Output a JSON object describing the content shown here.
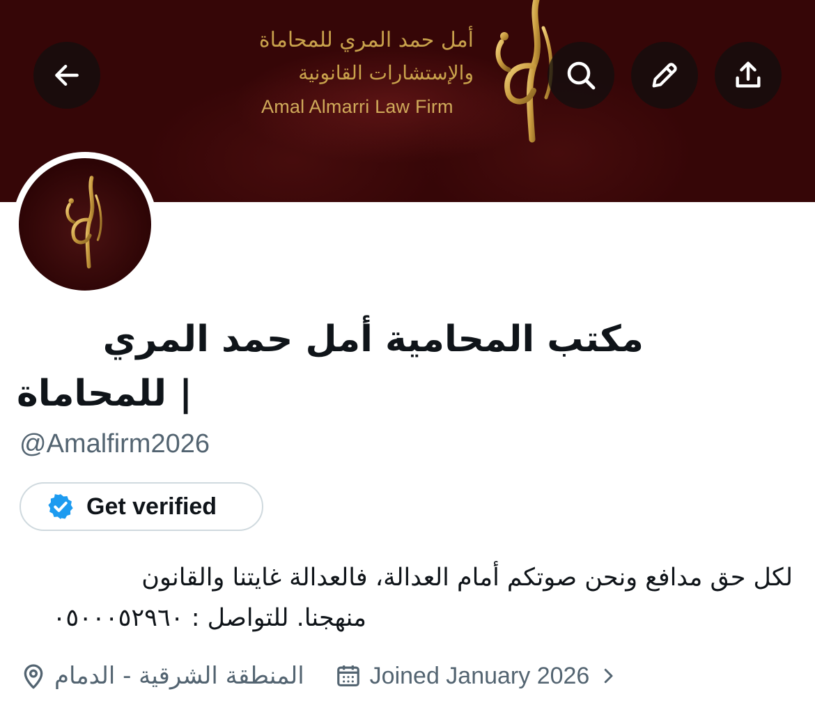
{
  "banner": {
    "arabic_line_1": "أمل حمد المري للمحاماة",
    "arabic_line_2": "والإستشارات القانونية",
    "english_name": "Amal Almarri Law Firm",
    "background_color": "#360607",
    "gold_color": "#c9a24c"
  },
  "toolbar": {
    "back_icon": "arrow-left-icon",
    "search_icon": "search-icon",
    "edit_icon": "pencil-icon",
    "share_icon": "share-upload-icon"
  },
  "profile": {
    "display_name_line1": "مكتب المحامية أمل حمد المري",
    "display_name_line2": "| للمحاماة",
    "handle": "@Amalfirm2026",
    "verify_button_label": "Get verified",
    "verify_badge_color": "#1d9bf0",
    "bio_line1": "لكل حق مدافع ونحن صوتكم أمام العدالة، فالعدالة غايتنا والقانون",
    "bio_line2": "منهجنا. للتواصل : ٠٥٠٠٠٥٢٩٦٠",
    "location": "المنطقة الشرقية - الدمام",
    "joined": "Joined January 2026"
  },
  "colors": {
    "text_primary": "#0f1419",
    "text_secondary": "#536471",
    "border": "#cfd9de"
  }
}
